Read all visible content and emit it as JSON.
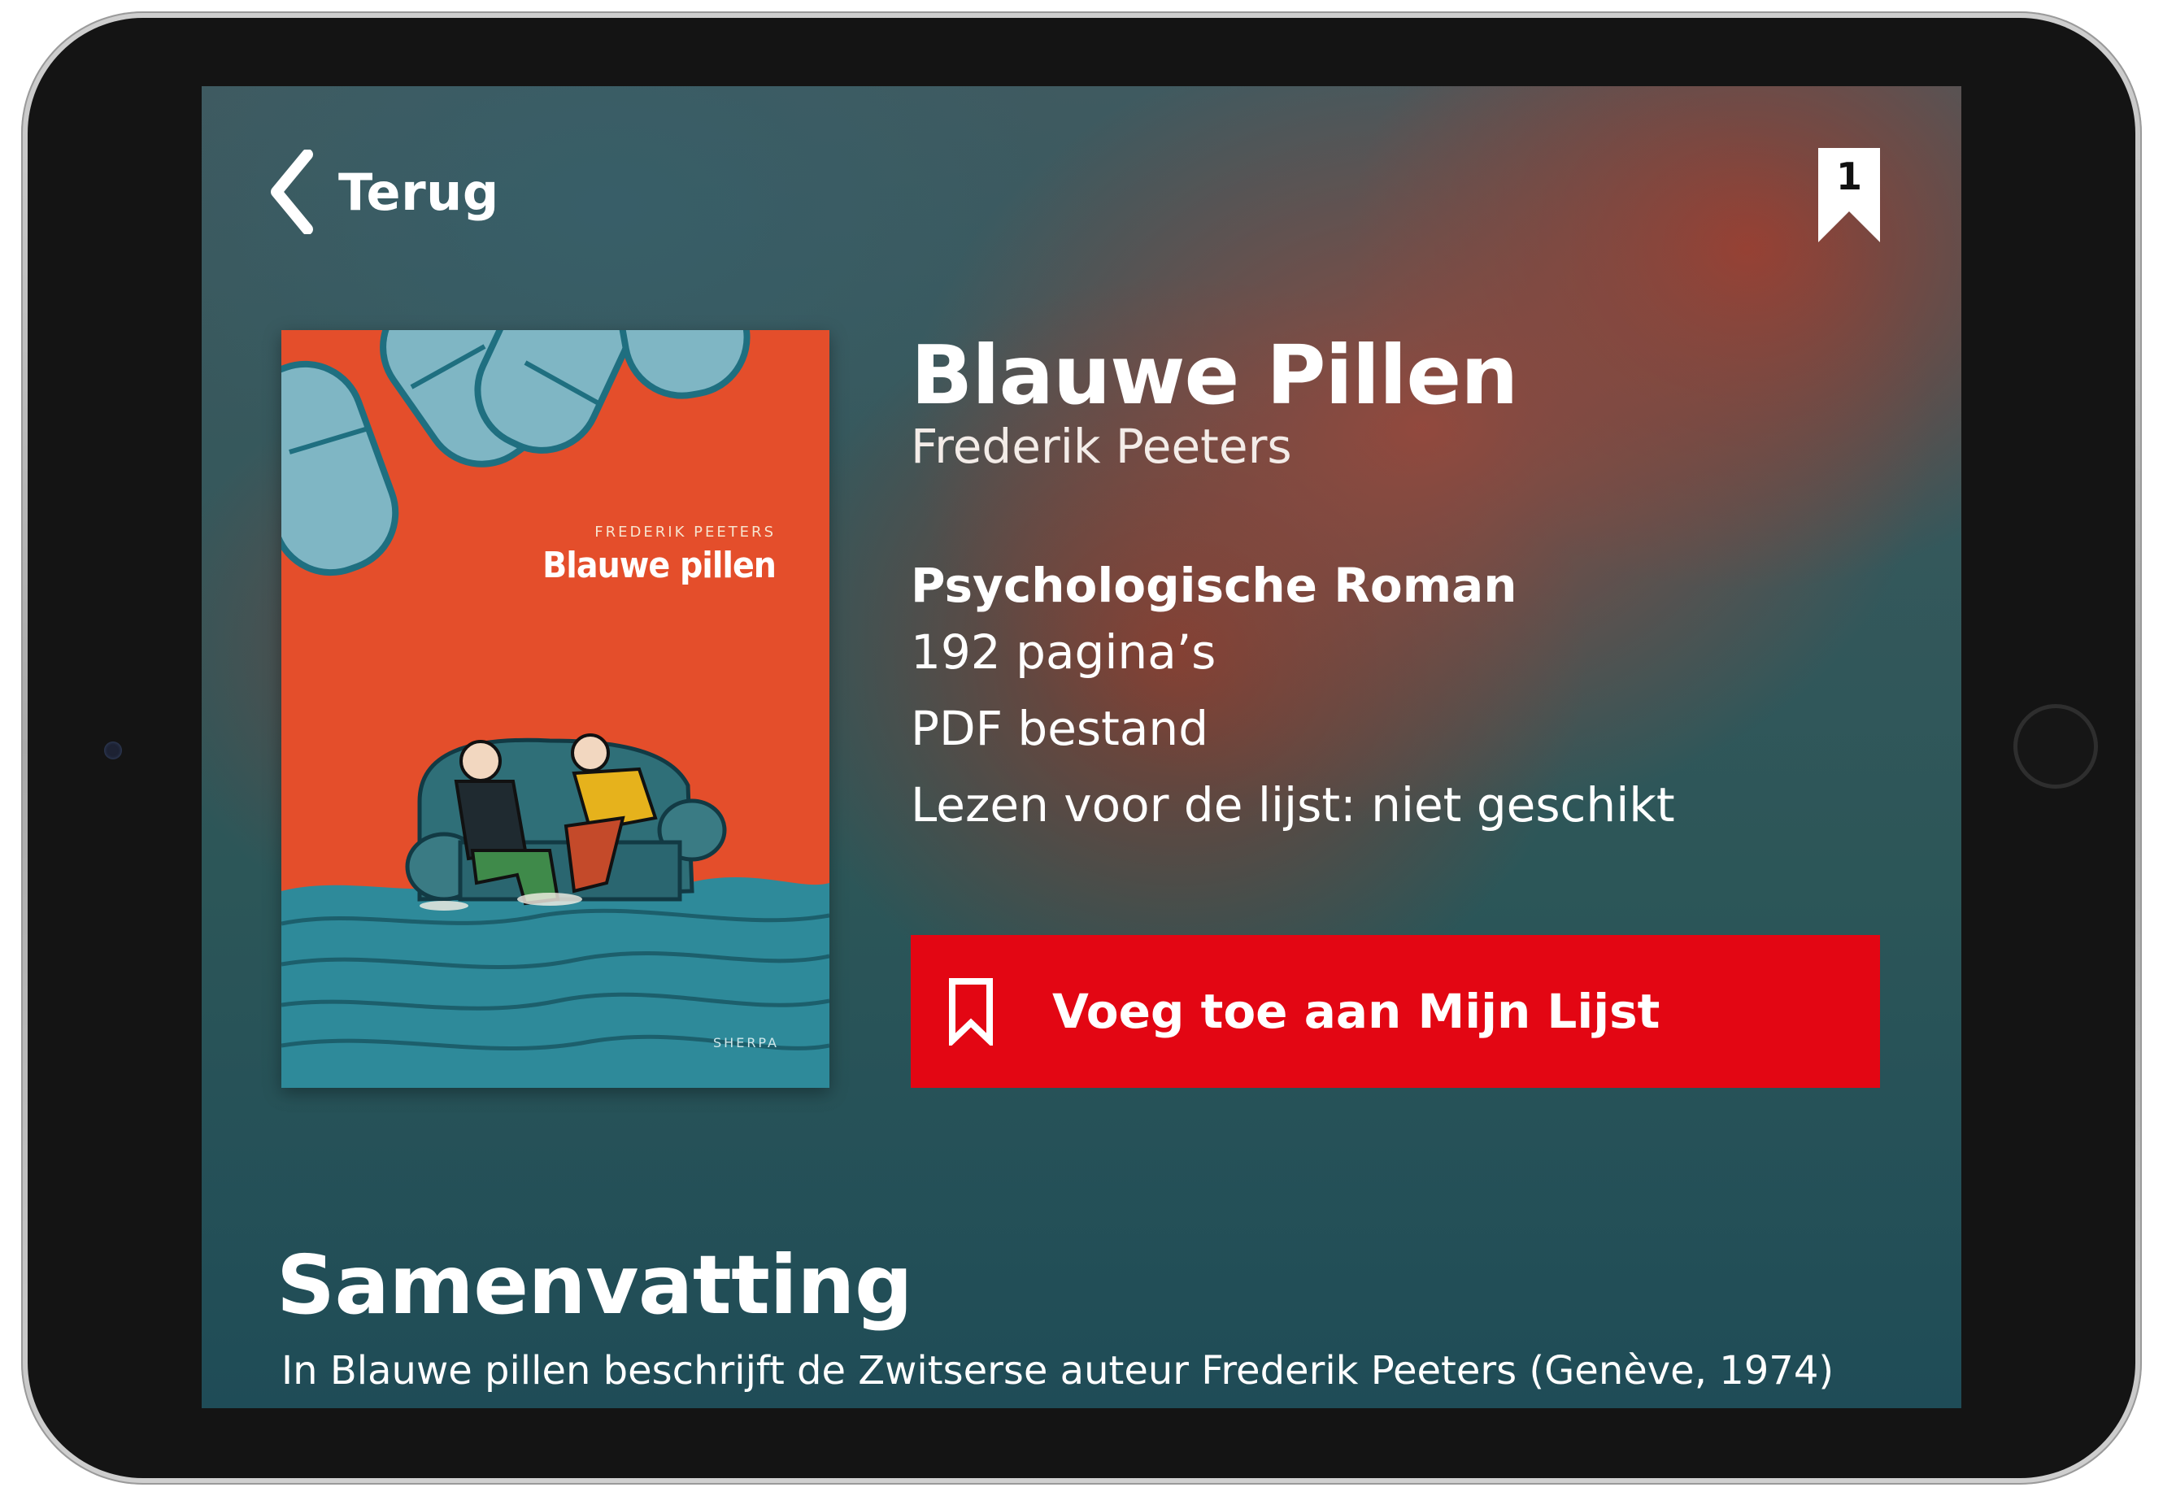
{
  "nav": {
    "back_label": "Terug",
    "back_icon": "chevron-left-icon",
    "list_count": "1",
    "list_icon": "bookmark-icon"
  },
  "book": {
    "title": "Blauwe Pillen",
    "author": "Frederik Peeters",
    "genre": "Psychologische Roman",
    "pages": "192 pagina’s",
    "format": "PDF bestand",
    "reading_list": "Lezen voor de lijst: niet geschikt"
  },
  "cover": {
    "author": "FREDERIK PEETERS",
    "title": "Blauwe pillen",
    "publisher": "SHERPA",
    "background_color": "#e44e2b",
    "water_color": "#2e8a9a"
  },
  "actions": {
    "add_label": "Voeg toe aan Mijn Lijst",
    "add_icon": "bookmark-outline-icon",
    "accent_color": "#e30613"
  },
  "summary": {
    "heading": "Samenvatting",
    "text": "In Blauwe pillen beschrijft de Zwitserse auteur Frederik Peeters (Genève, 1974)"
  }
}
